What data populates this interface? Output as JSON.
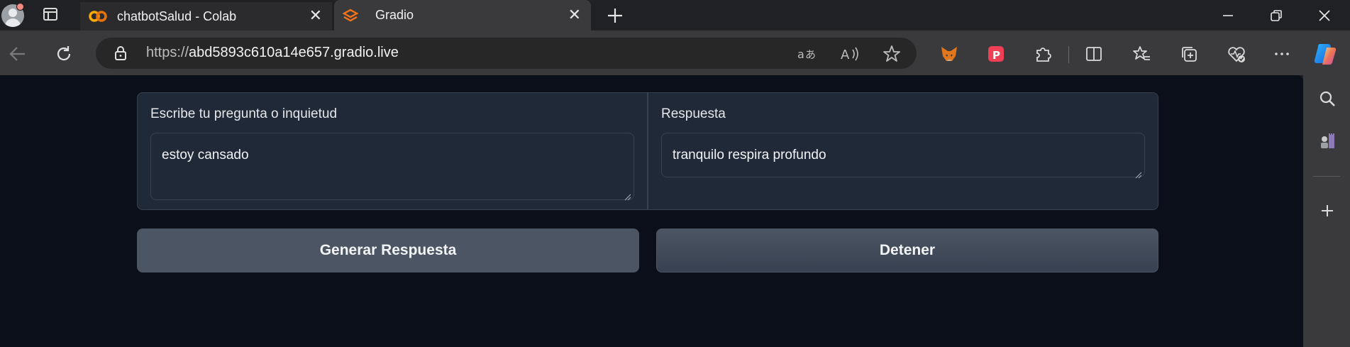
{
  "browser": {
    "tabs": [
      {
        "title": "chatbotSalud - Colab",
        "icon": "colab-icon",
        "active": false
      },
      {
        "title": "Gradio",
        "icon": "gradio-icon",
        "active": true
      }
    ],
    "url_protocol": "https://",
    "url_host": "abd5893c610a14e657.gradio.live",
    "accent_color": "#e8710a"
  },
  "form": {
    "input_label": "Escribe tu pregunta o inquietud",
    "input_value": "estoy cansado",
    "output_label": "Respuesta",
    "output_value": "tranquilo respira profundo",
    "generate_label": "Generar Respuesta",
    "stop_label": "Detener"
  }
}
